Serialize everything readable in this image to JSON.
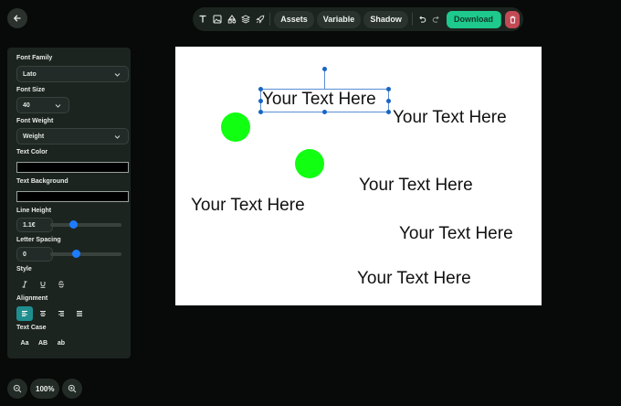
{
  "toolbar": {
    "assets_label": "Assets",
    "variable_label": "Variable",
    "shadow_label": "Shadow",
    "download_label": "Download"
  },
  "panel": {
    "font_family_label": "Font Family",
    "font_family_value": "Lato",
    "font_size_label": "Font Size",
    "font_size_value": "40",
    "font_weight_label": "Font Weight",
    "font_weight_value": "Weight",
    "text_color_label": "Text Color",
    "text_color_value": "#000000",
    "text_background_label": "Text Background",
    "text_background_value": "#000000",
    "line_height_label": "Line Height",
    "line_height_value": "1.1€",
    "line_height_level": 0.3,
    "letter_spacing_label": "Letter Spacing",
    "letter_spacing_value": "0",
    "letter_spacing_level": 0.35,
    "style_label": "Style",
    "alignment_label": "Alignment",
    "text_case_label": "Text Case",
    "case_options": [
      "Aa",
      "AB",
      "ab"
    ]
  },
  "zoom": {
    "level": "100%"
  },
  "canvas": {
    "text_items": [
      "Your Text Here",
      "Your Text Here",
      "Your Text Here",
      "Your Text Here",
      "Your Text Here",
      "Your Text Here"
    ],
    "circle_color": "#11ff11"
  },
  "colors": {
    "accent": "#1ec98e",
    "danger": "#c24a55",
    "active": "#1f8e8f"
  }
}
